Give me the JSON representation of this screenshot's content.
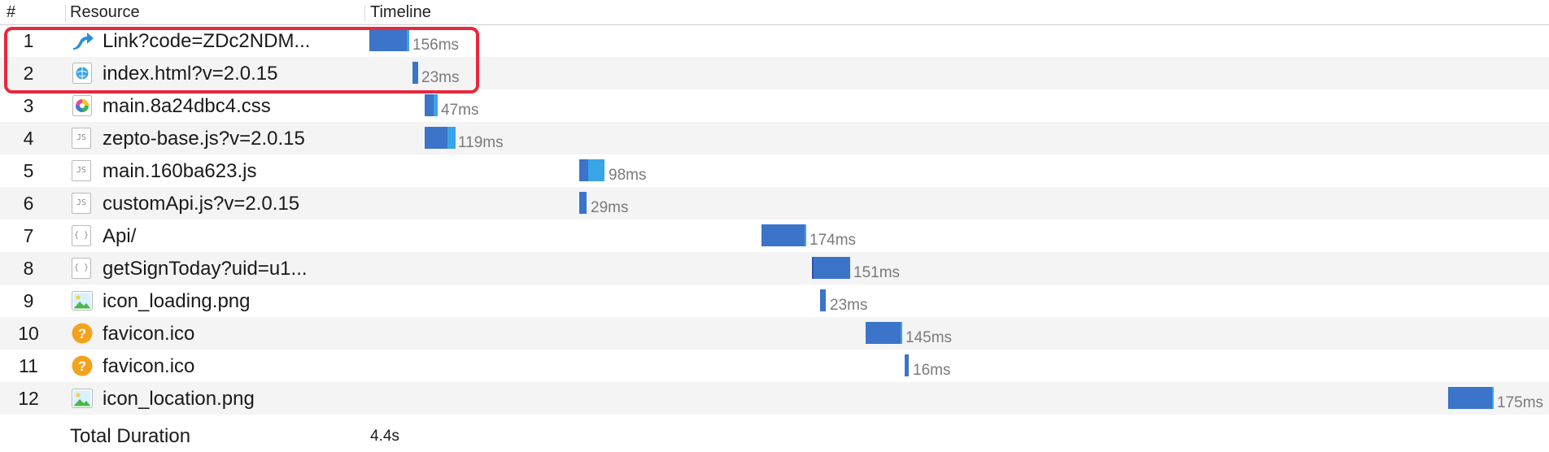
{
  "header": {
    "num": "#",
    "resource": "Resource",
    "timeline": "Timeline"
  },
  "rows": [
    {
      "num": "1",
      "name": "Link?code=ZDc2NDM...",
      "duration": "156ms",
      "icon": "redirect-arrow-icon"
    },
    {
      "num": "2",
      "name": "index.html?v=2.0.15",
      "duration": "23ms",
      "icon": "html-document-icon"
    },
    {
      "num": "3",
      "name": "main.8a24dbc4.css",
      "duration": "47ms",
      "icon": "css-stylesheet-icon"
    },
    {
      "num": "4",
      "name": "zepto-base.js?v=2.0.15",
      "duration": "119ms",
      "icon": "js-file-icon"
    },
    {
      "num": "5",
      "name": "main.160ba623.js",
      "duration": "98ms",
      "icon": "js-file-icon"
    },
    {
      "num": "6",
      "name": "customApi.js?v=2.0.15",
      "duration": "29ms",
      "icon": "js-file-icon"
    },
    {
      "num": "7",
      "name": "Api/",
      "duration": "174ms",
      "icon": "json-file-icon"
    },
    {
      "num": "8",
      "name": "getSignToday?uid=u1...",
      "duration": "151ms",
      "icon": "json-file-icon"
    },
    {
      "num": "9",
      "name": "icon_loading.png",
      "duration": "23ms",
      "icon": "image-file-icon"
    },
    {
      "num": "10",
      "name": "favicon.ico",
      "duration": "145ms",
      "icon": "question-mark-icon"
    },
    {
      "num": "11",
      "name": "favicon.ico",
      "duration": "16ms",
      "icon": "question-mark-icon"
    },
    {
      "num": "12",
      "name": "icon_location.png",
      "duration": "175ms",
      "icon": "image-file-icon"
    }
  ],
  "total": {
    "label": "Total Duration",
    "value": "4.4s"
  },
  "colors": {
    "bar_main": "#3b74c8",
    "bar_receive": "#3aa4e8",
    "highlight": "#e8283c",
    "alt_row": "#f4f4f4"
  }
}
